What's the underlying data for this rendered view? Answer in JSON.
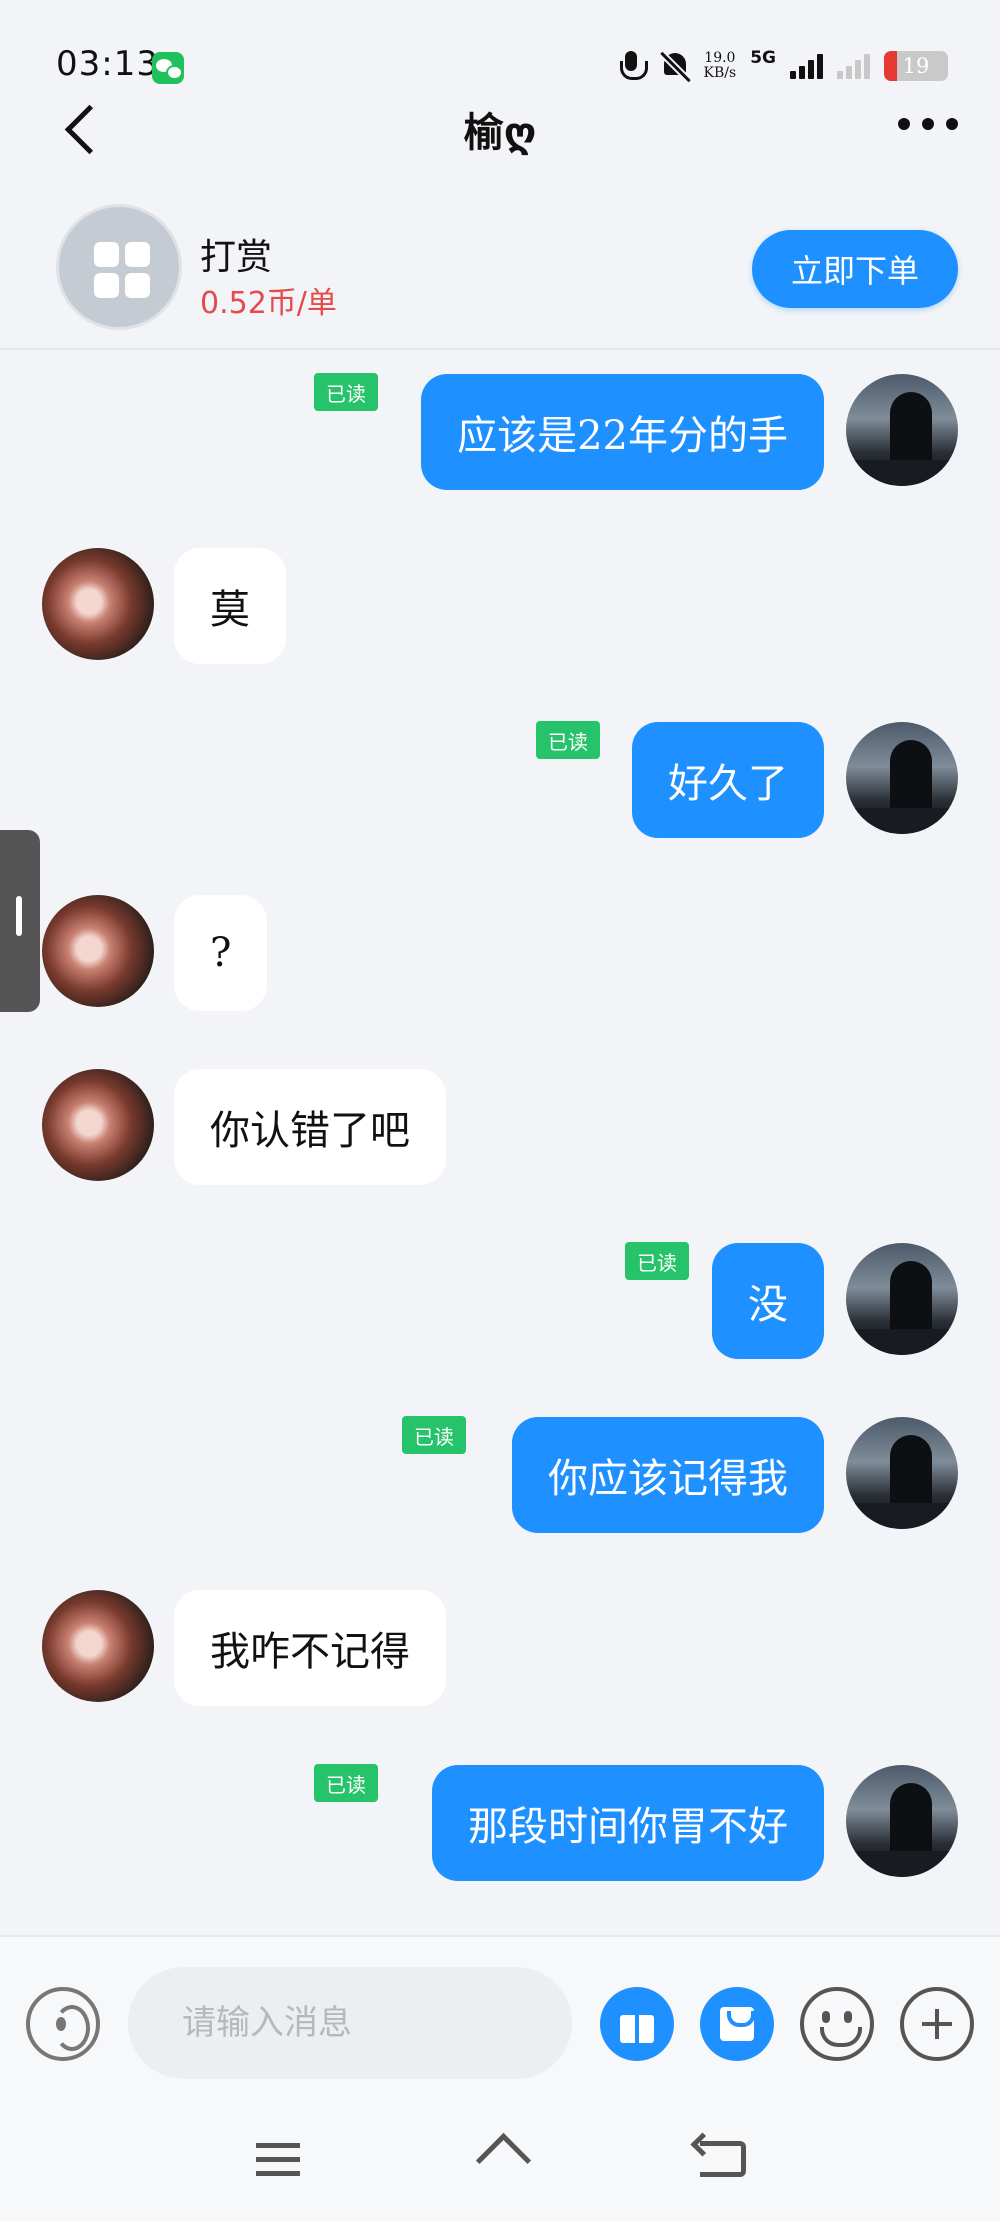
{
  "status_bar": {
    "time": "03:13",
    "net_speed_value": "19.0",
    "net_speed_unit": "KB/s",
    "network": "5G",
    "battery": "19"
  },
  "header": {
    "title": "榆ღ"
  },
  "reward": {
    "title": "打赏",
    "price": "0.52币/单",
    "order_button": "立即下单"
  },
  "messages": [
    {
      "side": "out",
      "text": "应该是22年分的手",
      "read": "已读"
    },
    {
      "side": "in",
      "text": "莫"
    },
    {
      "side": "out",
      "text": "好久了",
      "read": "已读"
    },
    {
      "side": "in",
      "text": "?"
    },
    {
      "side": "in",
      "text": "你认错了吧"
    },
    {
      "side": "out",
      "text": "没",
      "read": "已读"
    },
    {
      "side": "out",
      "text": "你应该记得我",
      "read": "已读"
    },
    {
      "side": "in",
      "text": "我咋不记得"
    },
    {
      "side": "out",
      "text": "那段时间你胃不好",
      "read": "已读"
    }
  ],
  "input": {
    "placeholder": "请输入消息"
  },
  "colors": {
    "accent": "#1e90ff",
    "read_tag": "#27c36a",
    "price": "#e54b4b",
    "background": "#f2f4f7"
  },
  "icons": [
    "wechat-icon",
    "mic-icon",
    "bell-off-icon",
    "signal-icon",
    "battery-icon",
    "back-icon",
    "more-icon",
    "voice-icon",
    "gift-icon",
    "envelope-icon",
    "emoji-icon",
    "plus-icon",
    "nav-menu-icon",
    "nav-home-icon",
    "nav-back-icon"
  ]
}
